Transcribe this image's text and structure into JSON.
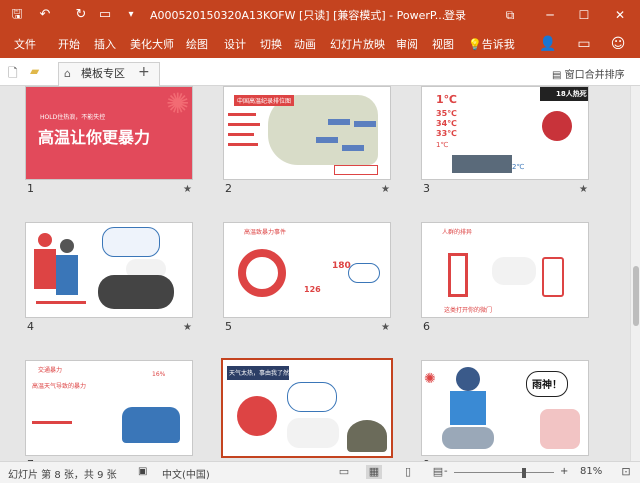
{
  "app": {
    "title": "A000520150320A13KOFW [只读] [兼容模式] - PowerP...",
    "login": "登录",
    "accent": "#c4431f"
  },
  "quick_access": [
    "save-icon",
    "undo-icon",
    "redo-icon",
    "customize-icon"
  ],
  "ribbon": {
    "tabs": [
      "文件",
      "开始",
      "插入",
      "美化大师",
      "绘图",
      "设计",
      "切换",
      "动画",
      "幻灯片放映",
      "审阅",
      "视图"
    ],
    "tell_me": "告诉我"
  },
  "tabbar": {
    "template_tab": "模板专区",
    "plus": "+",
    "merge": "窗口合并排序"
  },
  "slides": [
    {
      "num": "1",
      "title_text": "高温让你更暴力",
      "hold_text": "HOLD住热浪，不能失控"
    },
    {
      "num": "2",
      "title_text": "中国高温纪录排位图"
    },
    {
      "num": "3",
      "big_text": "1℃",
      "labels": [
        "35℃",
        "34℃",
        "33℃",
        "1℃",
        "2℃"
      ],
      "badge": "18人热死"
    },
    {
      "num": "4"
    },
    {
      "num": "5",
      "title_text": "高温致暴力事件",
      "values": [
        "180",
        "126"
      ]
    },
    {
      "num": "6",
      "title_text": "人群的排异",
      "label": "这类打开你的微门"
    },
    {
      "num": "7",
      "title_text": "交通暴力",
      "label": "高温天气导致的暴力",
      "percent": "16%"
    },
    {
      "num": "8",
      "title_text": "天气太热，事由我了然"
    },
    {
      "num": "9",
      "bubble": "雨神！"
    }
  ],
  "status": {
    "slide_info": "幻灯片 第 8 张，共 9 张",
    "lang": "中文(中国)",
    "zoom": "81%",
    "zoom_minus": "-",
    "zoom_plus": "+"
  }
}
